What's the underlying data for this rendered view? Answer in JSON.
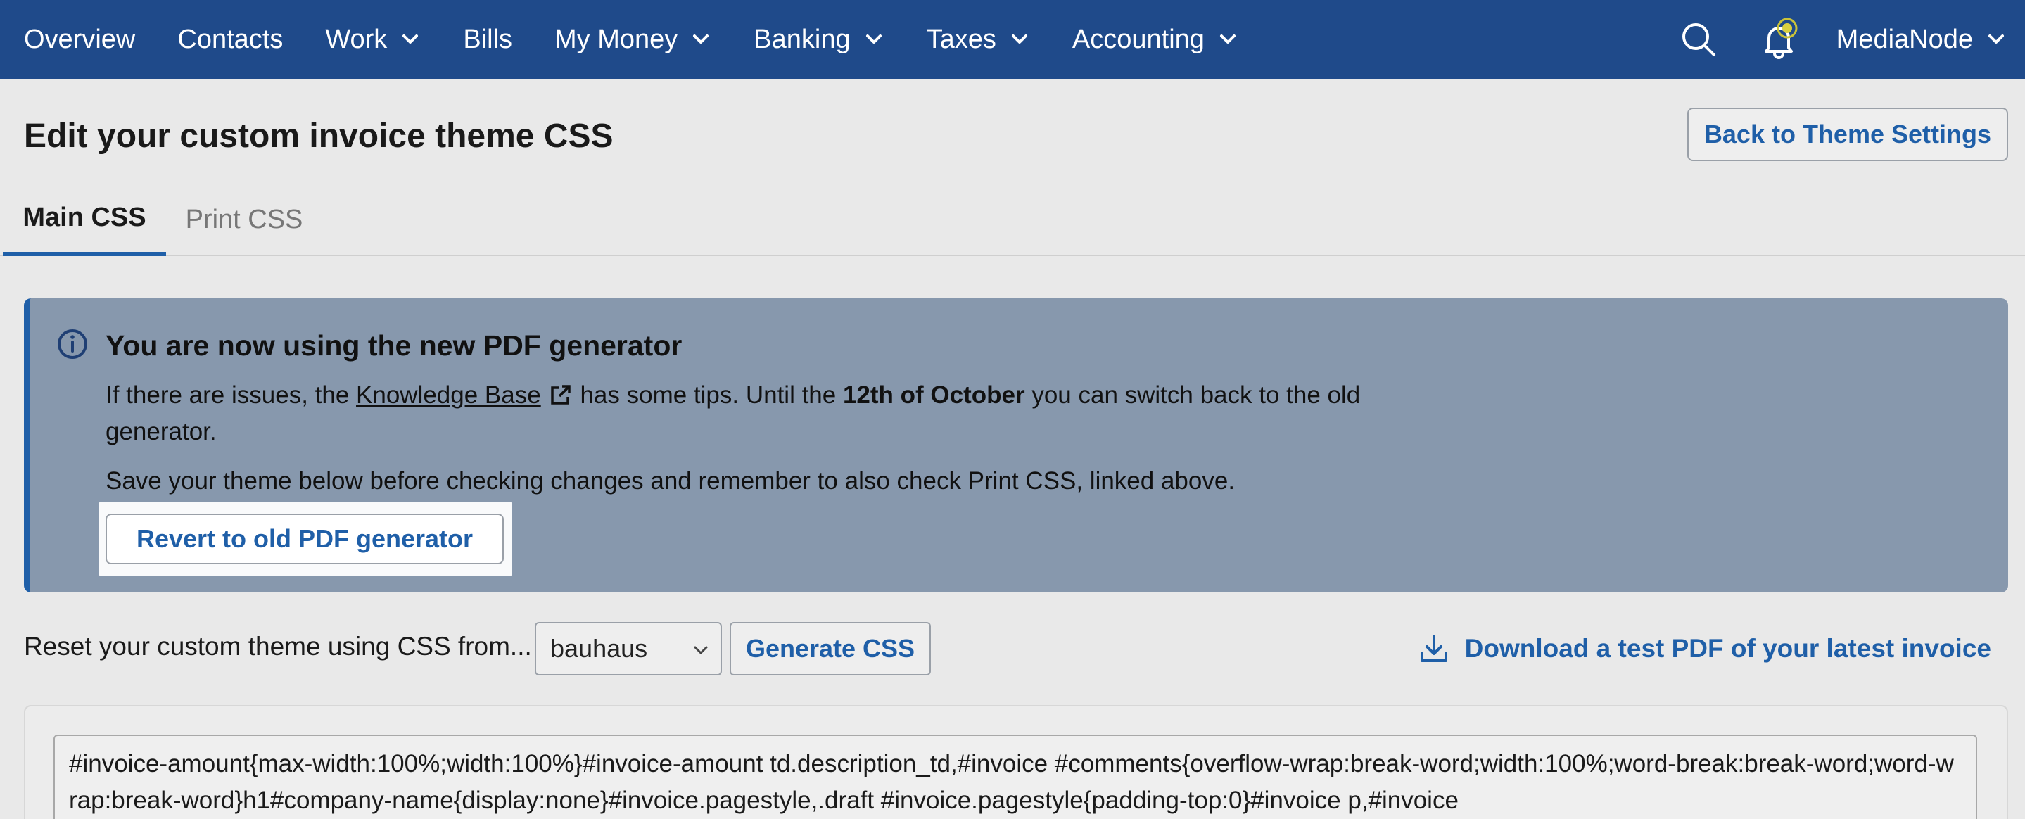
{
  "nav": {
    "items": [
      {
        "label": "Overview",
        "dropdown": false
      },
      {
        "label": "Contacts",
        "dropdown": false
      },
      {
        "label": "Work",
        "dropdown": true
      },
      {
        "label": "Bills",
        "dropdown": false
      },
      {
        "label": "My Money",
        "dropdown": true
      },
      {
        "label": "Banking",
        "dropdown": true
      },
      {
        "label": "Taxes",
        "dropdown": true
      },
      {
        "label": "Accounting",
        "dropdown": true
      }
    ],
    "account": "MediaNode",
    "icons": {
      "search": "search-icon",
      "notifications": "bell-icon"
    }
  },
  "page": {
    "title": "Edit your custom invoice theme CSS",
    "back_button": "Back to Theme Settings"
  },
  "tabs": [
    {
      "label": "Main CSS",
      "active": true
    },
    {
      "label": "Print CSS",
      "active": false
    }
  ],
  "info": {
    "title": "You are now using the new PDF generator",
    "p1_prefix": "If there are issues, the ",
    "p1_link": "Knowledge Base",
    "p1_mid": " has some tips. Until the ",
    "p1_bold": "12th of October",
    "p1_suffix": " you can switch back to the old generator.",
    "p2": "Save your theme below before checking changes and remember to also check Print CSS, linked above.",
    "revert_button": "Revert to old PDF generator"
  },
  "reset": {
    "label": "Reset your custom theme using CSS from...",
    "selected_theme": "bauhaus",
    "generate_button": "Generate CSS",
    "download_link": "Download a test PDF of your latest invoice"
  },
  "editor": {
    "value": "#invoice-amount{max-width:100%;width:100%}#invoice-amount td.description_td,#invoice #comments{overflow-wrap:break-word;width:100%;word-break:break-word;word-wrap:break-word}h1#company-name{display:none}#invoice.pagestyle,.draft #invoice.pagestyle{padding-top:0}#invoice p,#invoice"
  },
  "colors": {
    "nav_bg": "#1f4a8a",
    "accent": "#1f5fa8",
    "info_bg": "#8798ad"
  }
}
